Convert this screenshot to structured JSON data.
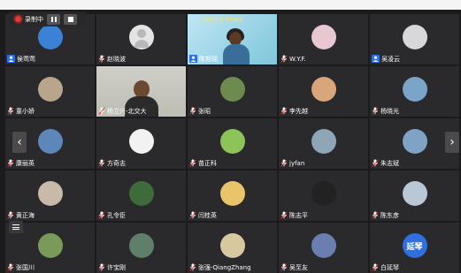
{
  "recording": {
    "label": "录制中"
  },
  "participants": [
    {
      "name": "侯莺莺",
      "role": "host",
      "avatar": {
        "kind": "img",
        "color": "#3b82d6"
      }
    },
    {
      "name": "赵晓波",
      "role": "mic",
      "avatar": {
        "kind": "gray"
      }
    },
    {
      "name": "陈旭瑶",
      "role": "host",
      "avatar": {
        "kind": "share"
      },
      "share_banner": "大手拉小手 共同成长"
    },
    {
      "name": "W.Y.F.",
      "role": "mic",
      "avatar": {
        "kind": "img",
        "color": "#e8c7d0"
      }
    },
    {
      "name": "吴凌云",
      "role": "host",
      "avatar": {
        "kind": "img",
        "color": "#d8d8d8"
      }
    },
    {
      "name": "童小娇",
      "role": "mic",
      "avatar": {
        "kind": "img",
        "color": "#b8a58c"
      }
    },
    {
      "name": "杨立兴-北交大",
      "role": "mic",
      "avatar": {
        "kind": "video"
      }
    },
    {
      "name": "张昭",
      "role": "mic",
      "avatar": {
        "kind": "img",
        "color": "#6d8a4f"
      }
    },
    {
      "name": "李先越",
      "role": "mic",
      "avatar": {
        "kind": "img",
        "color": "#d9a57a"
      }
    },
    {
      "name": "杨晓光",
      "role": "mic",
      "avatar": {
        "kind": "img",
        "color": "#7aa4c8"
      }
    },
    {
      "name": "康丽英",
      "role": "mic",
      "avatar": {
        "kind": "img",
        "color": "#5d87b8"
      }
    },
    {
      "name": "方奇志",
      "role": "mic",
      "avatar": {
        "kind": "img",
        "color": "#f2f2f2"
      }
    },
    {
      "name": "苗正科",
      "role": "mic",
      "avatar": {
        "kind": "img",
        "color": "#8cc45a"
      }
    },
    {
      "name": "jyfan",
      "role": "mic",
      "avatar": {
        "kind": "img",
        "color": "#8fa5b8"
      }
    },
    {
      "name": "朱志斌",
      "role": "mic",
      "avatar": {
        "kind": "img",
        "color": "#7fa3c4"
      }
    },
    {
      "name": "黄正海",
      "role": "mic",
      "avatar": {
        "kind": "img",
        "color": "#c8b9a8"
      }
    },
    {
      "name": "孔令臣",
      "role": "mic",
      "avatar": {
        "kind": "img",
        "color": "#3f6b3a"
      }
    },
    {
      "name": "闫桂英",
      "role": "mic",
      "avatar": {
        "kind": "img",
        "color": "#e9c46a"
      }
    },
    {
      "name": "陈志平",
      "role": "mic",
      "avatar": {
        "kind": "img",
        "color": "#222222"
      }
    },
    {
      "name": "陈东彦",
      "role": "mic",
      "avatar": {
        "kind": "img",
        "color": "#b9c7d6"
      }
    },
    {
      "name": "张国川",
      "role": "mic",
      "avatar": {
        "kind": "img",
        "color": "#7a9a5a"
      }
    },
    {
      "name": "许宝刚",
      "role": "mic",
      "avatar": {
        "kind": "img",
        "color": "#5f7f6a"
      }
    },
    {
      "name": "张强-QiangZhang",
      "role": "mic",
      "avatar": {
        "kind": "img",
        "color": "#d7c8a0"
      }
    },
    {
      "name": "吴至友",
      "role": "mic",
      "avatar": {
        "kind": "img",
        "color": "#6a7fb0"
      }
    },
    {
      "name": "白延琴",
      "role": "mic",
      "avatar": {
        "kind": "text",
        "color": "#2f6fe0",
        "text": "延琴"
      }
    }
  ]
}
